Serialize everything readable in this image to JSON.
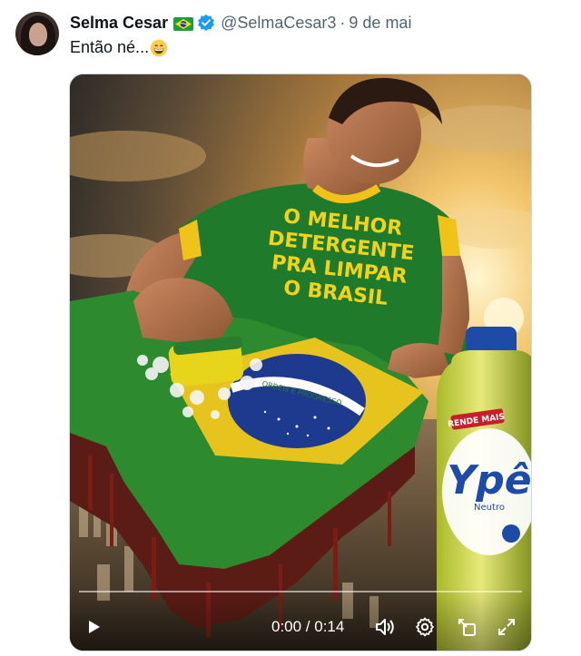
{
  "tweet": {
    "display_name": "Selma Cesar",
    "flag_icon": "brazil-flag-icon",
    "verified_icon": "verified-badge-icon",
    "handle": "@SelmaCesar3",
    "separator": "·",
    "date": "9 de mai",
    "text": "Então né...",
    "emoji_icon": "grinning-face-emoji",
    "verified_color": "#1d9bf0"
  },
  "media": {
    "shirt_text": [
      "O MELHOR",
      "DETERGENTE",
      "PRA LIMPAR",
      "O BRASIL"
    ],
    "flag_band_text": "ORDEM E PROGRESSO",
    "bottle_label": {
      "top": "RENDE MAIS",
      "brand": "Ypê",
      "variant": "Neutro"
    }
  },
  "video": {
    "play_icon": "play-icon",
    "time_current": "0:00",
    "time_separator": " / ",
    "time_total": "0:14",
    "time_text": "0:00 / 0:14",
    "volume_icon": "volume-icon",
    "settings_icon": "gear-icon",
    "popout_icon": "popout-icon",
    "fullscreen_icon": "fullscreen-icon",
    "progress": 0.0
  }
}
